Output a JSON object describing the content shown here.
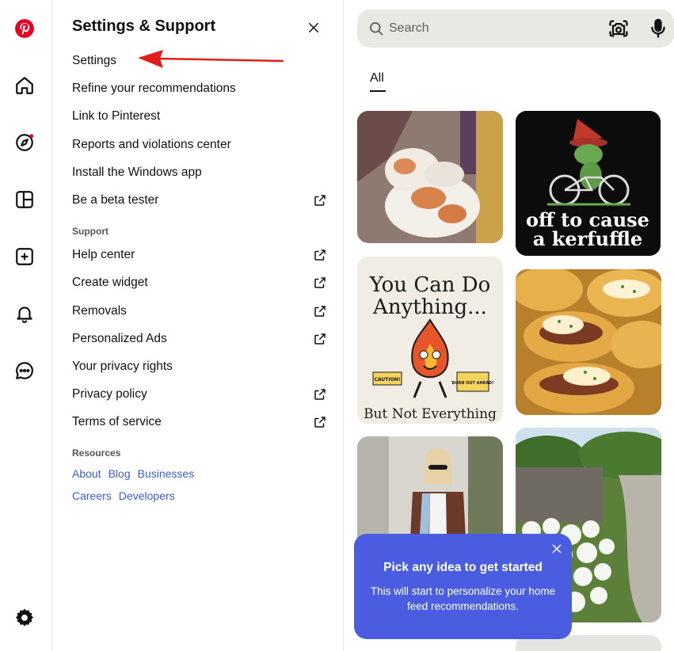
{
  "panel": {
    "title": "Settings & Support",
    "items": [
      {
        "label": "Settings",
        "external": false
      },
      {
        "label": "Refine your recommendations",
        "external": false
      },
      {
        "label": "Link to Pinterest",
        "external": false
      },
      {
        "label": "Reports and violations center",
        "external": false
      },
      {
        "label": "Install the Windows app",
        "external": false
      },
      {
        "label": "Be a beta tester",
        "external": true
      }
    ],
    "support_label": "Support",
    "support_items": [
      {
        "label": "Help center",
        "external": true
      },
      {
        "label": "Create widget",
        "external": true
      },
      {
        "label": "Removals",
        "external": true
      },
      {
        "label": "Personalized Ads",
        "external": true
      },
      {
        "label": "Your privacy rights",
        "external": false
      },
      {
        "label": "Privacy policy",
        "external": true
      },
      {
        "label": "Terms of service",
        "external": true
      }
    ],
    "resources_label": "Resources",
    "resources_row1": [
      "About",
      "Blog",
      "Businesses"
    ],
    "resources_row2": [
      "Careers",
      "Developers"
    ]
  },
  "search": {
    "placeholder": "Search"
  },
  "tabs": {
    "all": "All"
  },
  "pins": {
    "frog_text_line1": "off to cause",
    "frog_text_line2": "a kerfuffle",
    "fire_text_top1": "You Can Do",
    "fire_text_top2": "Anything...",
    "fire_text_bottom": "But Not Everything",
    "fire_badge_left": "CAUTION!",
    "fire_badge_right": "BURN OUT AHEAD!"
  },
  "toast": {
    "title": "Pick any idea to get started",
    "body": "This will start to personalize your home feed recommendations."
  },
  "colors": {
    "brand_red": "#e60023",
    "link_blue": "#3b5bd6",
    "toast_blue": "#4a5de0",
    "arrow_red": "#e0211b"
  },
  "icons": {
    "rail": [
      "pinterest-logo",
      "home-icon",
      "explore-icon",
      "boards-icon",
      "create-icon",
      "notifications-icon",
      "messages-icon",
      "settings-gear-icon"
    ]
  }
}
